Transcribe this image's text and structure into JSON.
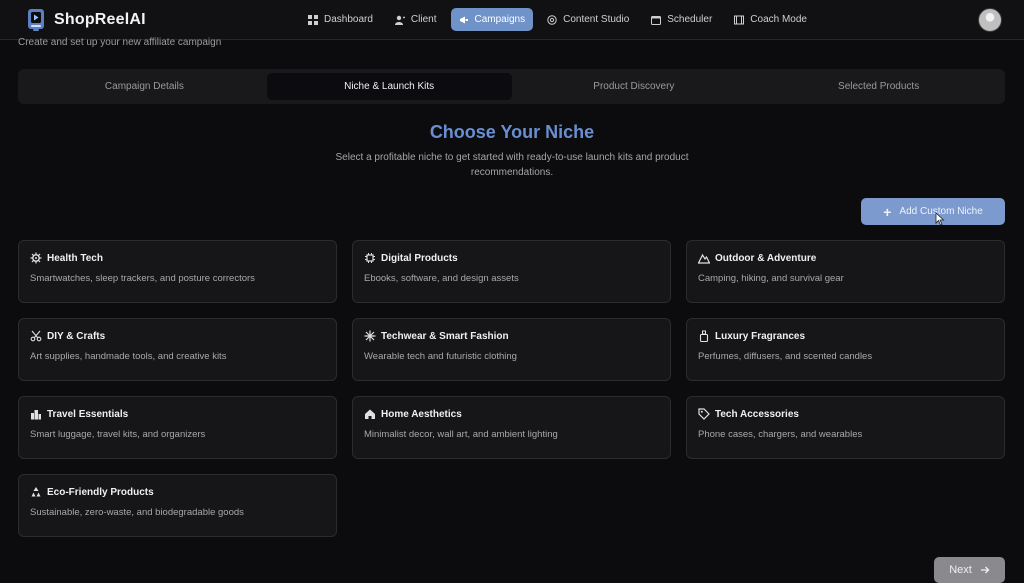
{
  "app": {
    "name": "ShopReelAI"
  },
  "nav": {
    "items": [
      {
        "label": "Dashboard",
        "icon": "grid-icon",
        "active": false
      },
      {
        "label": "Client",
        "icon": "user-plus-icon",
        "active": false
      },
      {
        "label": "Campaigns",
        "icon": "megaphone-icon",
        "active": true
      },
      {
        "label": "Content Studio",
        "icon": "aperture-icon",
        "active": false
      },
      {
        "label": "Scheduler",
        "icon": "calendar-icon",
        "active": false
      },
      {
        "label": "Coach Mode",
        "icon": "film-icon",
        "active": false
      }
    ]
  },
  "page": {
    "subtitle": "Create and set up your new affiliate campaign"
  },
  "tabs": [
    {
      "label": "Campaign Details",
      "active": false
    },
    {
      "label": "Niche & Launch Kits",
      "active": true
    },
    {
      "label": "Product Discovery",
      "active": false
    },
    {
      "label": "Selected Products",
      "active": false
    }
  ],
  "niche": {
    "title": "Choose Your Niche",
    "description": "Select a profitable niche to get started with ready-to-use launch kits and product recommendations.",
    "add_button": "Add Custom Niche",
    "cards": [
      {
        "title": "Health Tech",
        "desc": "Smartwatches, sleep trackers, and posture correctors",
        "icon": "gear-icon"
      },
      {
        "title": "Digital Products",
        "desc": "Ebooks, software, and design assets",
        "icon": "chip-icon"
      },
      {
        "title": "Outdoor & Adventure",
        "desc": "Camping, hiking, and survival gear",
        "icon": "mountain-icon"
      },
      {
        "title": "DIY & Crafts",
        "desc": "Art supplies, handmade tools, and creative kits",
        "icon": "scissors-icon"
      },
      {
        "title": "Techwear & Smart Fashion",
        "desc": "Wearable tech and futuristic clothing",
        "icon": "sparkle-icon"
      },
      {
        "title": "Luxury Fragrances",
        "desc": "Perfumes, diffusers, and scented candles",
        "icon": "perfume-icon"
      },
      {
        "title": "Travel Essentials",
        "desc": "Smart luggage, travel kits, and organizers",
        "icon": "city-icon"
      },
      {
        "title": "Home Aesthetics",
        "desc": "Minimalist decor, wall art, and ambient lighting",
        "icon": "home-icon"
      },
      {
        "title": "Tech Accessories",
        "desc": "Phone cases, chargers, and wearables",
        "icon": "tag-icon"
      },
      {
        "title": "Eco-Friendly Products",
        "desc": "Sustainable, zero-waste, and biodegradable goods",
        "icon": "recycle-icon"
      }
    ]
  },
  "footer": {
    "next_label": "Next"
  },
  "colors": {
    "accent": "#6a8fd0",
    "active_nav": "#6f92c9",
    "background": "#0c0c0e",
    "card": "#161618"
  }
}
